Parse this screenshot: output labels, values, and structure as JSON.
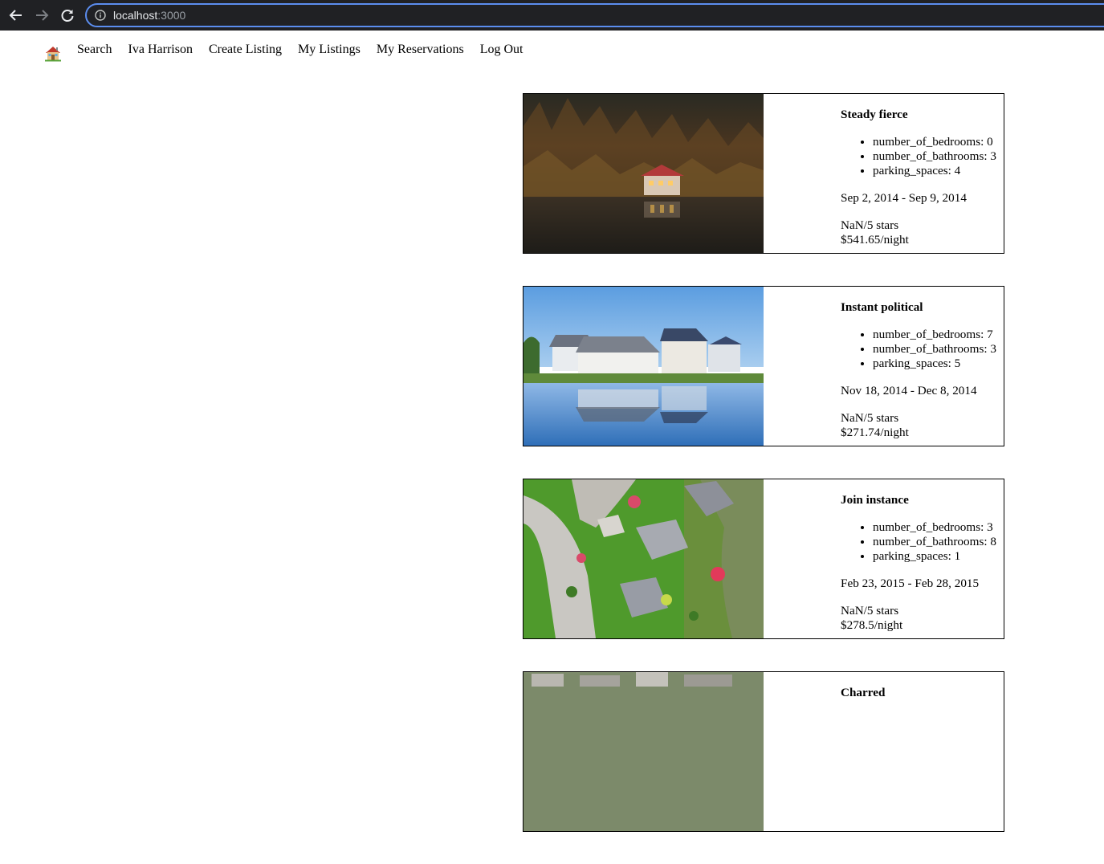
{
  "browser": {
    "url_host": "localhost",
    "url_port": ":3000"
  },
  "nav": {
    "home_icon": "house-emoji",
    "links": [
      {
        "label": "Search"
      },
      {
        "label": "Iva Harrison"
      },
      {
        "label": "Create Listing"
      },
      {
        "label": "My Listings"
      },
      {
        "label": "My Reservations"
      },
      {
        "label": "Log Out"
      }
    ]
  },
  "listings": [
    {
      "title": "Steady fierce",
      "features": [
        "number_of_bedrooms: 0",
        "number_of_bathrooms: 3",
        "parking_spaces: 4"
      ],
      "dates": "Sep 2, 2014 - Sep 9, 2014",
      "rating": "NaN/5 stars",
      "price": "$541.65/night"
    },
    {
      "title": "Instant political",
      "features": [
        "number_of_bedrooms: 7",
        "number_of_bathrooms: 3",
        "parking_spaces: 5"
      ],
      "dates": "Nov 18, 2014 - Dec 8, 2014",
      "rating": "NaN/5 stars",
      "price": "$271.74/night"
    },
    {
      "title": "Join instance",
      "features": [
        "number_of_bedrooms: 3",
        "number_of_bathrooms: 8",
        "parking_spaces: 1"
      ],
      "dates": "Feb 23, 2015 - Feb 28, 2015",
      "rating": "NaN/5 stars",
      "price": "$278.5/night"
    },
    {
      "title": "Charred"
    }
  ]
}
